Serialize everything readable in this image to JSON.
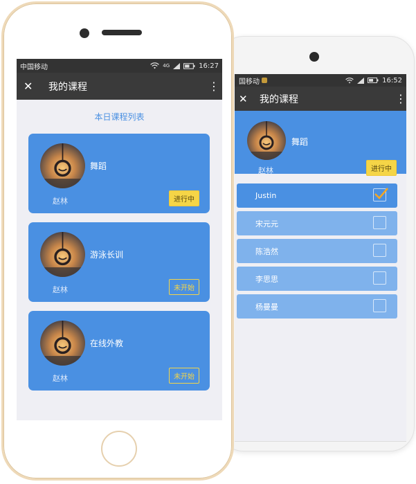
{
  "colors": {
    "accent": "#4a90e2",
    "accent_light": "#7fb2ec",
    "badge_yellow": "#f5d547",
    "statusbar": "#333333",
    "navbar": "#3a3a3a",
    "background": "#efeff4",
    "phone_gold": "#eed9b8"
  },
  "front_phone": {
    "status": {
      "carrier": "中国移动",
      "signal": "4G",
      "time": "16:27"
    },
    "nav": {
      "close_icon": "close-icon",
      "title": "我的课程",
      "more_icon": "more-vertical-icon"
    },
    "section_title": "本日课程列表",
    "courses": [
      {
        "name": "舞蹈",
        "teacher": "赵林",
        "status": "进行中",
        "status_type": "active"
      },
      {
        "name": "游泳长训",
        "teacher": "赵林",
        "status": "未开始",
        "status_type": "pending"
      },
      {
        "name": "在线外教",
        "teacher": "赵林",
        "status": "未开始",
        "status_type": "pending"
      }
    ]
  },
  "back_phone": {
    "status": {
      "carrier": "国移动",
      "time": "16:52"
    },
    "nav": {
      "close_icon": "close-icon",
      "title": "我的课程",
      "more_icon": "more-vertical-icon"
    },
    "course": {
      "name": "舞蹈",
      "teacher": "赵林",
      "status": "进行中"
    },
    "students": [
      {
        "name": "Justin",
        "checked": true
      },
      {
        "name": "宋元元",
        "checked": false
      },
      {
        "name": "陈浩然",
        "checked": false
      },
      {
        "name": "李思思",
        "checked": false
      },
      {
        "name": "杨曼曼",
        "checked": false
      }
    ]
  }
}
